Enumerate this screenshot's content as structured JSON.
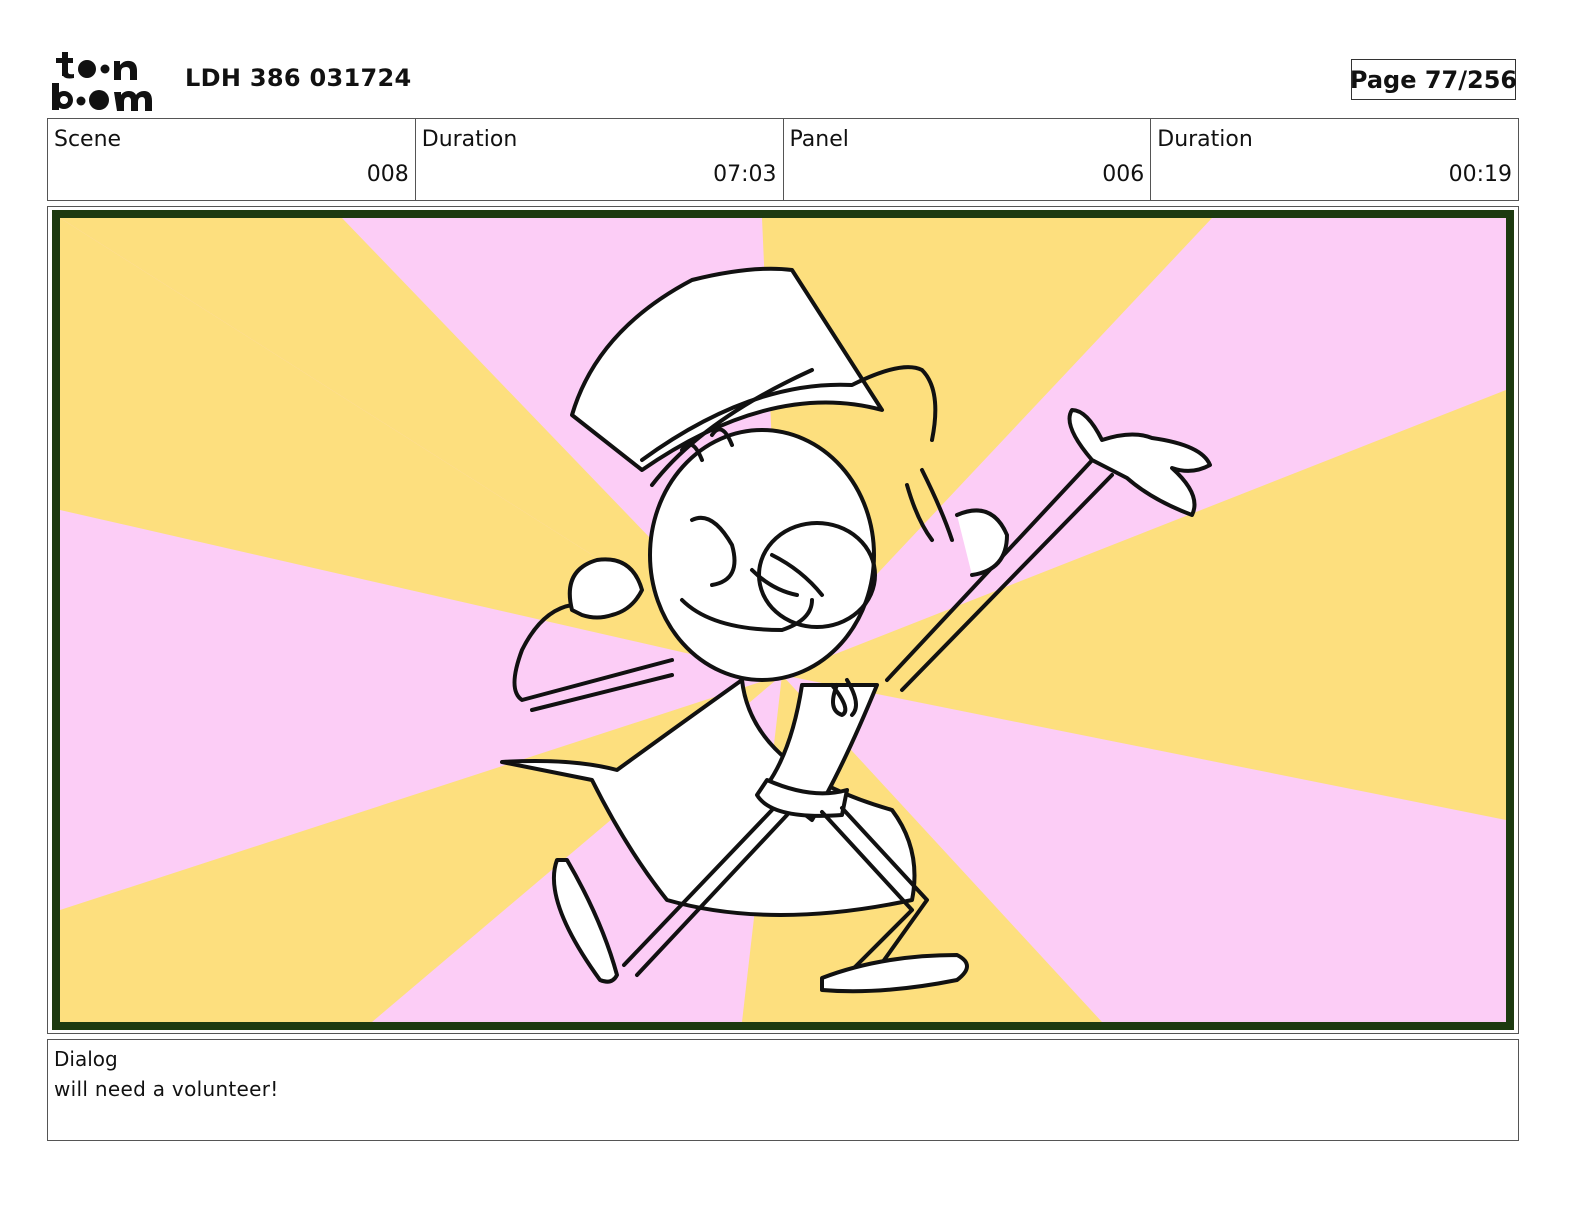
{
  "header": {
    "logo_text": "toonboom",
    "title": "LDH 386 031724",
    "page_label": "Page",
    "page_value": "77/256"
  },
  "info": [
    {
      "label": "Scene",
      "value": "008"
    },
    {
      "label": "Duration",
      "value": "07:03"
    },
    {
      "label": "Panel",
      "value": "006"
    },
    {
      "label": "Duration",
      "value": "00:19"
    }
  ],
  "panel": {
    "background_colors": {
      "yellow": "#fddf7e",
      "pink": "#fccdf6",
      "border": "#1d3a10"
    },
    "subject": "magician-character-sketch"
  },
  "dialog": {
    "label": "Dialog",
    "text": "will need a volunteer!"
  }
}
